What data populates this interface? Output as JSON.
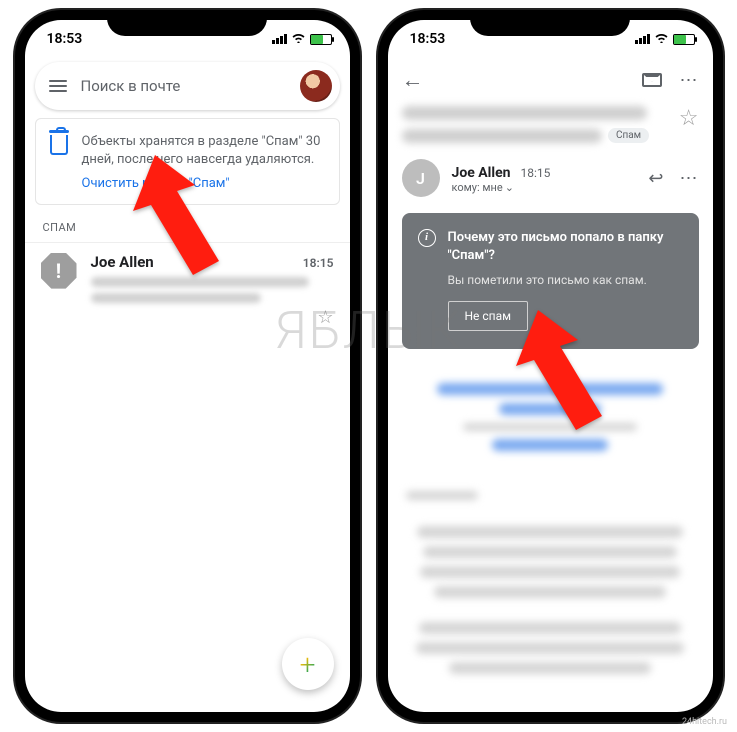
{
  "status_time": "18:53",
  "watermark": "ЯБЛЫК",
  "left": {
    "search_placeholder": "Поиск в почте",
    "info_text": "Объекты хранятся в разделе \"Спам\" 30 дней, после чего навсегда удаляются.",
    "info_link": "Очистить раздел \"Спам\"",
    "section": "СПАМ",
    "mail": {
      "from": "Joe Allen",
      "time": "18:15"
    }
  },
  "right": {
    "spam_chip": "Спам",
    "sender": {
      "initial": "J",
      "name": "Joe Allen",
      "time": "18:15",
      "to": "кому: мне"
    },
    "spam_box": {
      "title": "Почему это письмо попало в папку \"Спам\"?",
      "reason": "Вы пометили это письмо как спам.",
      "button": "Не спам"
    }
  },
  "footer": "24hitech.ru"
}
